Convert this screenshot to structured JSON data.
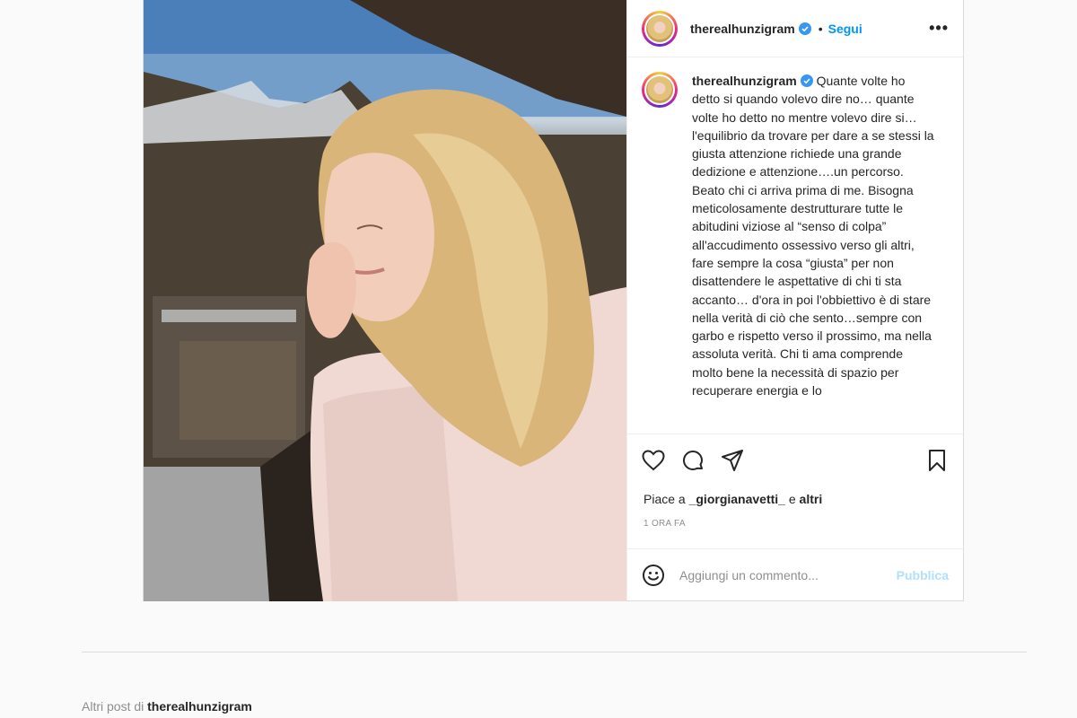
{
  "post": {
    "username": "therealhunzigram",
    "follow_label": "Segui",
    "more_label": "•••",
    "dot": "•",
    "caption_text": " Quante volte ho detto si quando volevo dire no… quante volte ho detto no mentre volevo dire si…l'equilibrio da trovare per dare a se stessi la giusta attenzione richiede una grande dedizione e attenzione….un percorso. Beato chi ci arriva prima di me. Bisogna meticolosamente destrutturare tutte le abitudini viziose al “senso di colpa” all'accudimento ossessivo verso gli altri, fare sempre la cosa “giusta” per non disattendere le aspettative di chi ti sta accanto… d'ora in poi l'obbiettivo è di stare nella verità di ciò che sento…sempre con garbo e rispetto verso il prossimo, ma nella assoluta verità. Chi ti ama comprende molto bene la necessità di spazio per recuperare energia e lo",
    "likes_prefix": "Piace a ",
    "likes_user": "_giorgianavetti_",
    "likes_mid": " e ",
    "likes_suffix": "altri",
    "time_label": "1 ora fa",
    "comment_placeholder": "Aggiungi un commento...",
    "publish_label": "Pubblica"
  },
  "footer": {
    "more_posts_prefix": "Altri post di ",
    "more_posts_user": "therealhunzigram"
  },
  "icons": {
    "like": "heart-icon",
    "comment": "comment-icon",
    "share": "paper-plane-icon",
    "save": "bookmark-icon",
    "emoji": "emoji-icon",
    "verified": "verified-badge-icon"
  },
  "colors": {
    "link_blue": "#0095f6",
    "verified_blue": "#3897f0",
    "publish_disabled": "#b2dffc",
    "muted": "#8e8e8e"
  }
}
